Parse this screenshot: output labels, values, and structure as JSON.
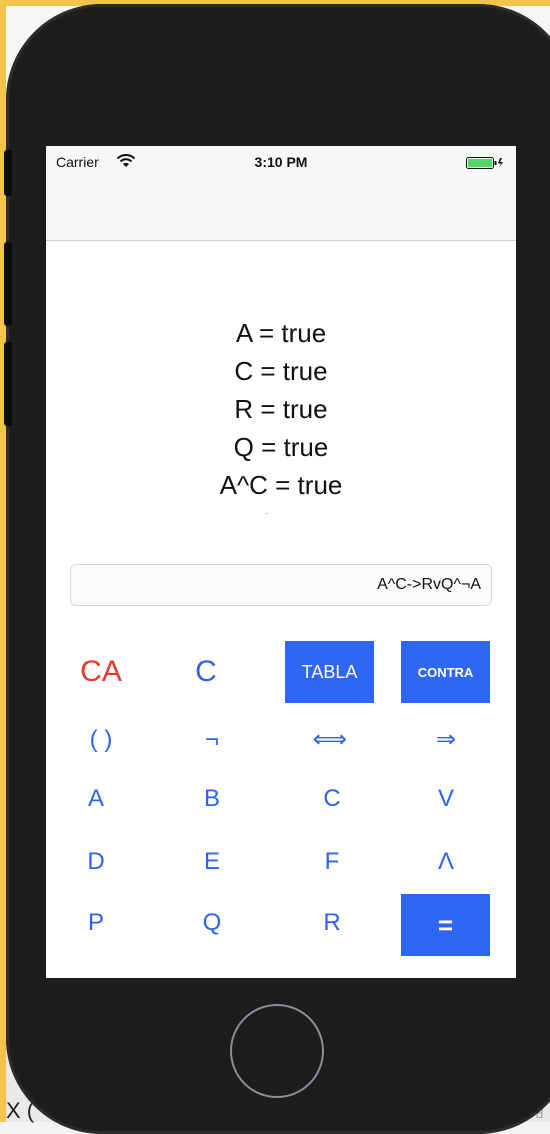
{
  "host": {
    "bottom_left_text": "X (",
    "bottom_right_text": "用"
  },
  "status_bar": {
    "carrier": "Carrier",
    "time": "3:10 PM",
    "wifi_icon": "wifi-icon",
    "battery_icon": "battery-icon"
  },
  "results": {
    "lines": [
      "A = true",
      "C = true",
      "R = true",
      "Q = true",
      "A^C = true",
      "R v Q = true"
    ]
  },
  "expression": {
    "value": "A^C->RvQ^¬A"
  },
  "keypad": {
    "row1": {
      "ca": "CA",
      "c": "C",
      "tabla": "TABLA",
      "contra": "CONTRA"
    },
    "row2": {
      "parens": "( )",
      "not": "¬",
      "iff": "⟺",
      "implies": "⇒"
    },
    "row3": {
      "a": "A",
      "b": "B",
      "c": "C",
      "or": "V"
    },
    "row4": {
      "d": "D",
      "e": "E",
      "f": "F",
      "and": "Λ"
    },
    "row5": {
      "p": "P",
      "q": "Q",
      "r": "R",
      "equals": "="
    }
  },
  "colors": {
    "accent": "#2f66f3",
    "text_blue": "#2e63f0",
    "danger": "#e8392b",
    "phone_frame": "#1d1d1f"
  }
}
